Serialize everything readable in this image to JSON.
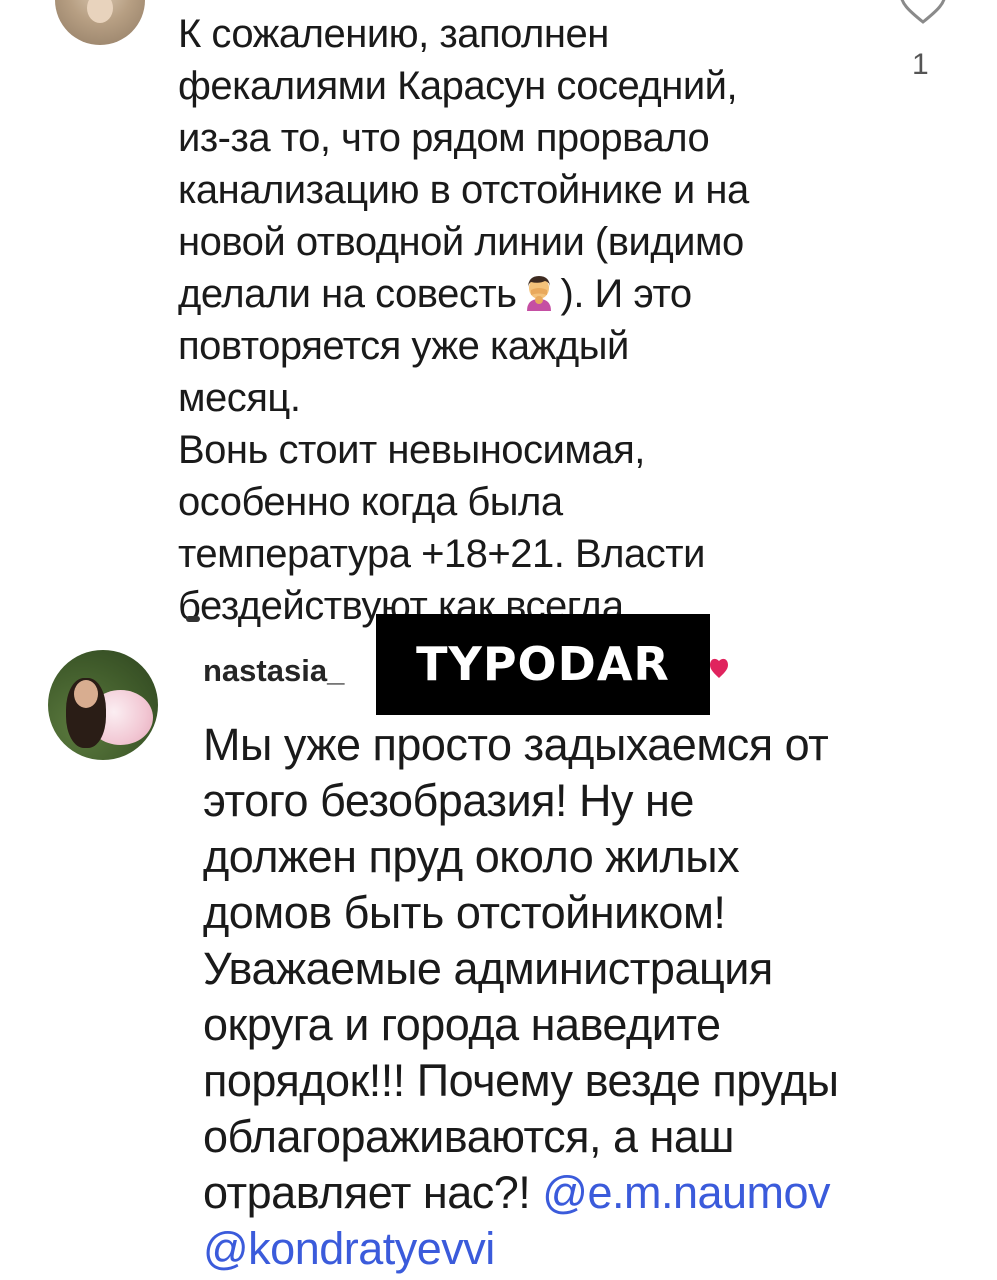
{
  "colors": {
    "text": "#1a1a1a",
    "mention": "#3b5bdb",
    "watermark_bg": "#000000",
    "watermark_fg": "#ffffff",
    "heart_red": "#e0245e"
  },
  "comment_1": {
    "avatar_icon": "user-avatar",
    "lines": [
      "К сожалению, заполнен",
      "фекалиями Карасун соседний,",
      "из-за то, что рядом прорвало",
      "канализацию в отстойнике и на",
      "новой отводной линии (видимо"
    ],
    "line_6_before_emoji": "делали на совесть",
    "emoji": "facepalm-icon",
    "line_6_after_emoji": "). И это",
    "lines_after": [
      "повторяется уже каждый",
      "месяц.",
      "Вонь стоит невыносимая,",
      "особенно когда была",
      "температура +18+21. Власти",
      "бездействуют как всегда."
    ],
    "like_count": "1",
    "like_icon": "heart-outline-icon"
  },
  "comment_2": {
    "avatar_icon": "user-avatar",
    "username": "nastasia_",
    "heart_icon": "heart-filled-icon",
    "lines": [
      "Мы уже просто задыхаемся от",
      "этого безобразия! Ну не",
      "должен пруд около жилых",
      "домов быть отстойником!",
      "Уважаемые администрация",
      "округа и города наведите",
      "порядок!!! Почему везде пруды",
      "облагораживаются, а наш"
    ],
    "last_line_text": "отравляет нас?! ",
    "mention_1": "@e.m.naumov",
    "mention_2": "@kondratyevvi"
  },
  "watermark": {
    "text": "TYPODAR"
  }
}
